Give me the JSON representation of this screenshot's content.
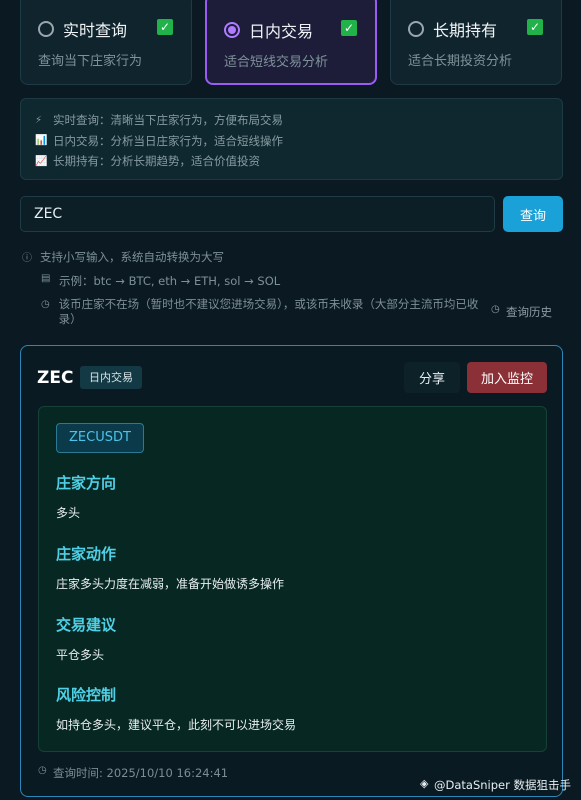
{
  "modes": [
    {
      "title": "实时查询",
      "desc": "查询当下庄家行为",
      "active": false
    },
    {
      "title": "日内交易",
      "desc": "适合短线交易分析",
      "active": true
    },
    {
      "title": "长期持有",
      "desc": "适合长期投资分析",
      "active": false
    }
  ],
  "tips": [
    {
      "icon": "⚡",
      "text": "实时查询：清晰当下庄家行为，方便布局交易"
    },
    {
      "icon": "📊",
      "text": "日内交易：分析当日庄家行为，适合短线操作"
    },
    {
      "icon": "📈",
      "text": "长期持有：分析长期趋势，适合价值投资"
    }
  ],
  "search": {
    "value": "ZEC",
    "button": "查询"
  },
  "hints": {
    "uppercase": "支持小写输入，系统自动转换为大写",
    "example": "示例：btc → BTC, eth → ETH, sol → SOL",
    "notice": "该币庄家不在场（暂时也不建议您进场交易），或该币未收录（大部分主流币均已收录）",
    "history": "查询历史"
  },
  "result": {
    "symbol": "ZEC",
    "mode": "日内交易",
    "share": "分享",
    "monitor": "加入监控",
    "pair": "ZECUSDT",
    "sections": [
      {
        "title": "庄家方向",
        "text": "多头"
      },
      {
        "title": "庄家动作",
        "text": "庄家多头力度在减弱，准备开始做诱多操作"
      },
      {
        "title": "交易建议",
        "text": "平仓多头"
      },
      {
        "title": "风险控制",
        "text": "如持仓多头，建议平仓，此刻不可以进场交易"
      }
    ],
    "query_time": "查询时间: 2025/10/10 16:24:41"
  },
  "watermark": "@DataSniper 数据狙击手",
  "colors": {
    "accent": "#9b5cf6",
    "primary_button": "#1aa2d8",
    "danger_button": "#8b3037",
    "section_title": "#4fd0e6"
  }
}
